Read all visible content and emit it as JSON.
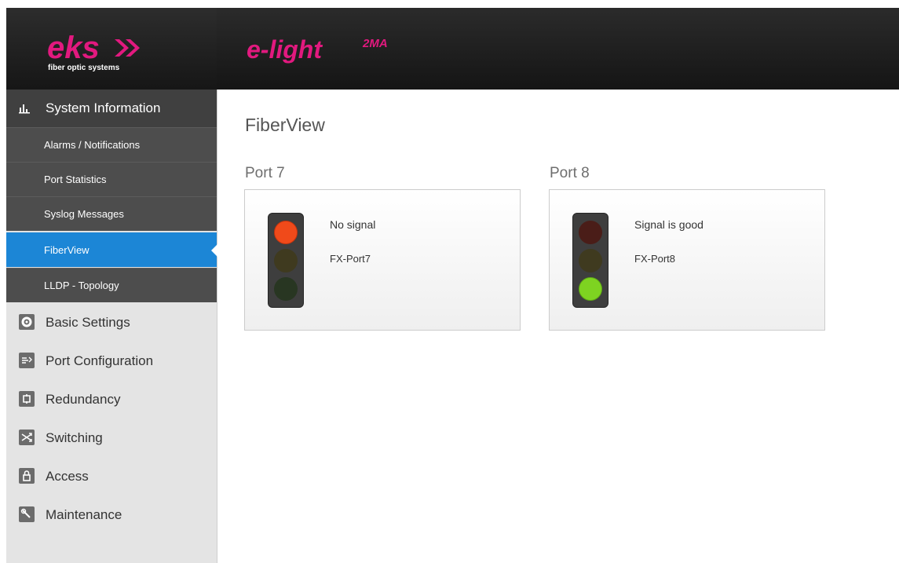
{
  "brand": {
    "logo_text": "eks",
    "tagline": "fiber optic systems",
    "product_main": "e-light",
    "product_sup": "2MA",
    "magenta": "#e2197f"
  },
  "sidebar": {
    "section_header": {
      "label": "System Information",
      "icon": "bar-chart-icon"
    },
    "sub_items": [
      {
        "label": "Alarms / Notifications",
        "active": false
      },
      {
        "label": "Port Statistics",
        "active": false
      },
      {
        "label": "Syslog Messages",
        "active": false
      },
      {
        "label": "FiberView",
        "active": true
      },
      {
        "label": "LLDP - Topology",
        "active": false
      }
    ],
    "items": [
      {
        "label": "Basic Settings",
        "icon": "gear-icon"
      },
      {
        "label": "Port Configuration",
        "icon": "port-config-icon"
      },
      {
        "label": "Redundancy",
        "icon": "redundancy-icon"
      },
      {
        "label": "Switching",
        "icon": "shuffle-icon"
      },
      {
        "label": "Access",
        "icon": "lock-icon"
      },
      {
        "label": "Maintenance",
        "icon": "wrench-icon"
      }
    ],
    "active_color": "#1c86d6"
  },
  "main": {
    "title": "FiberView",
    "ports": [
      {
        "title": "Port 7",
        "status": "No signal",
        "port_name": "FX-Port7",
        "active_lamp": "red"
      },
      {
        "title": "Port 8",
        "status": "Signal is good",
        "port_name": "FX-Port8",
        "active_lamp": "green"
      }
    ]
  },
  "colors": {
    "lamp_red_on": "#f04a1a",
    "lamp_green_on": "#7ed321",
    "lamp_red_off": "#4a1d18",
    "lamp_yellow_off": "#3f3a1f",
    "lamp_green_off": "#283622"
  }
}
